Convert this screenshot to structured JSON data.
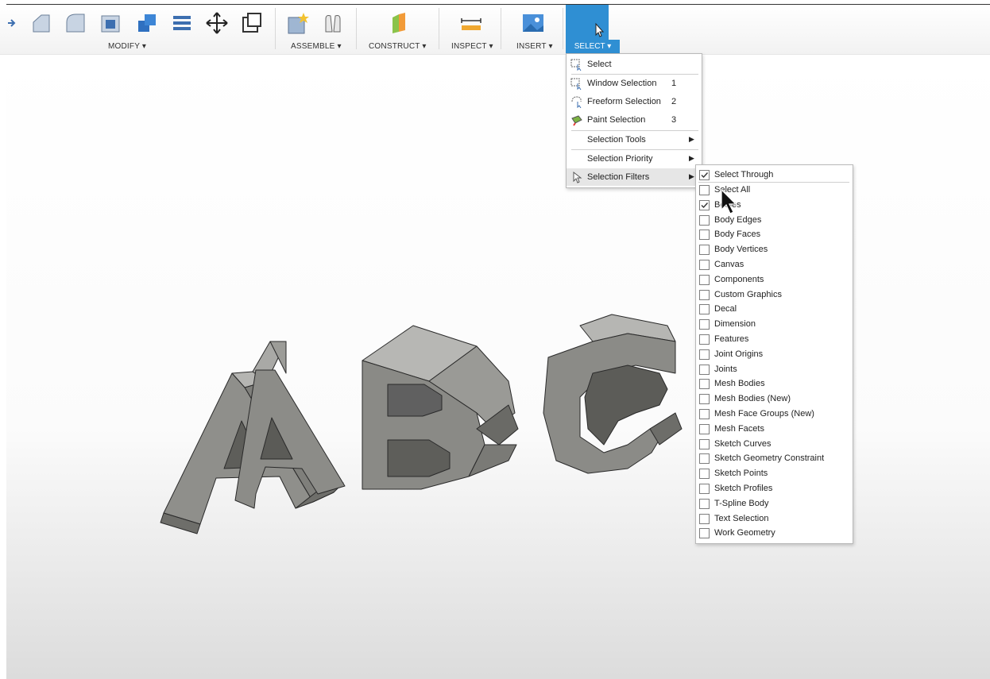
{
  "toolbar": {
    "groups": {
      "modify": "MODIFY ▾",
      "assemble": "ASSEMBLE ▾",
      "construct": "CONSTRUCT ▾",
      "inspect": "INSPECT ▾",
      "insert": "INSERT ▾",
      "select": "SELECT ▾"
    }
  },
  "select_menu": {
    "items": [
      {
        "label": "Select",
        "key": ""
      },
      {
        "label": "Window Selection",
        "key": "1"
      },
      {
        "label": "Freeform Selection",
        "key": "2"
      },
      {
        "label": "Paint Selection",
        "key": "3"
      },
      {
        "label": "Selection Tools",
        "key": ""
      },
      {
        "label": "Selection Priority",
        "key": ""
      },
      {
        "label": "Selection Filters",
        "key": ""
      }
    ]
  },
  "filter_menu": {
    "items": [
      {
        "label": "Select Through",
        "checked": true
      },
      {
        "label": "Select All",
        "checked": false
      },
      {
        "label": "Bodies",
        "checked": true
      },
      {
        "label": "Body Edges",
        "checked": false
      },
      {
        "label": "Body Faces",
        "checked": false
      },
      {
        "label": "Body Vertices",
        "checked": false
      },
      {
        "label": "Canvas",
        "checked": false
      },
      {
        "label": "Components",
        "checked": false
      },
      {
        "label": "Custom Graphics",
        "checked": false
      },
      {
        "label": "Decal",
        "checked": false
      },
      {
        "label": "Dimension",
        "checked": false
      },
      {
        "label": "Features",
        "checked": false
      },
      {
        "label": "Joint Origins",
        "checked": false
      },
      {
        "label": "Joints",
        "checked": false
      },
      {
        "label": "Mesh Bodies",
        "checked": false
      },
      {
        "label": "Mesh Bodies (New)",
        "checked": false
      },
      {
        "label": "Mesh Face Groups (New)",
        "checked": false
      },
      {
        "label": "Mesh Facets",
        "checked": false
      },
      {
        "label": "Sketch Curves",
        "checked": false
      },
      {
        "label": "Sketch Geometry Constraint",
        "checked": false
      },
      {
        "label": "Sketch Points",
        "checked": false
      },
      {
        "label": "Sketch Profiles",
        "checked": false
      },
      {
        "label": "T-Spline Body",
        "checked": false
      },
      {
        "label": "Text Selection",
        "checked": false
      },
      {
        "label": "Work Geometry",
        "checked": false
      }
    ]
  },
  "colors": {
    "accent": "#2f8fd3",
    "model_face": "#8e8e8a",
    "model_dark": "#6f6f6b"
  }
}
